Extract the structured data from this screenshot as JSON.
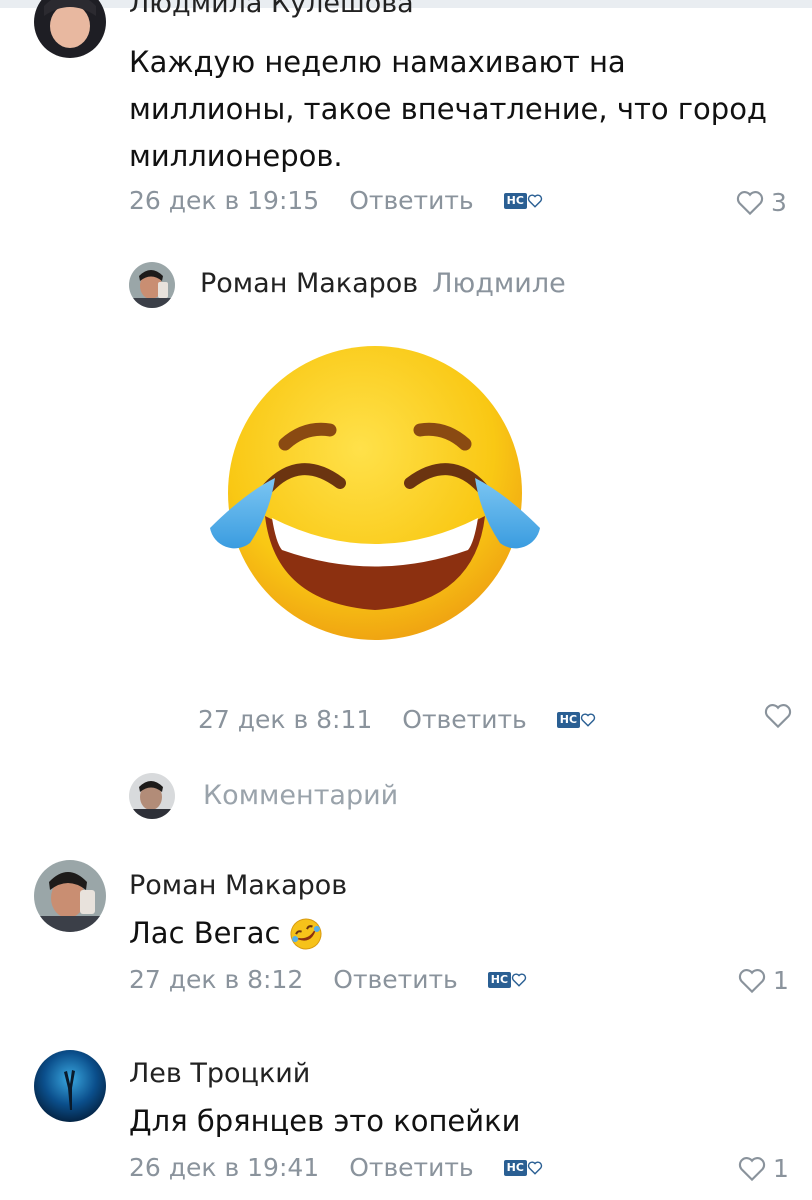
{
  "comments": [
    {
      "author": "Людмила Кулешова",
      "text_lines": [
        "Каждую неделю намахивают на",
        "миллионы, такое впечатление, что город",
        "миллионеров."
      ],
      "time": "26 дек в 19:15",
      "reply_label": "Ответить",
      "likes": "3"
    },
    {
      "author": "Роман Макаров",
      "reply_to": "Людмиле",
      "time": "27 дек в 8:11",
      "reply_label": "Ответить",
      "likes": ""
    },
    {
      "author": "Роман Макаров",
      "text": "Лас Вегас",
      "time": "27 дек в 8:12",
      "reply_label": "Ответить",
      "likes": "1"
    },
    {
      "author": "Лев Троцкий",
      "text": "Для брянцев это копейки",
      "time": "26 дек в 19:41",
      "reply_label": "Ответить",
      "likes": "1"
    }
  ],
  "reply_input": {
    "placeholder": "Комментарий"
  },
  "badge_text": "НС",
  "icons": {
    "sticker": "laughing-crying-emoji",
    "inline_emoji": "rofl-emoji",
    "like": "heart-outline-icon"
  },
  "colors": {
    "meta": "#8a939c",
    "badge": "#2a5f93",
    "emoji_face": "#f6c21a"
  }
}
